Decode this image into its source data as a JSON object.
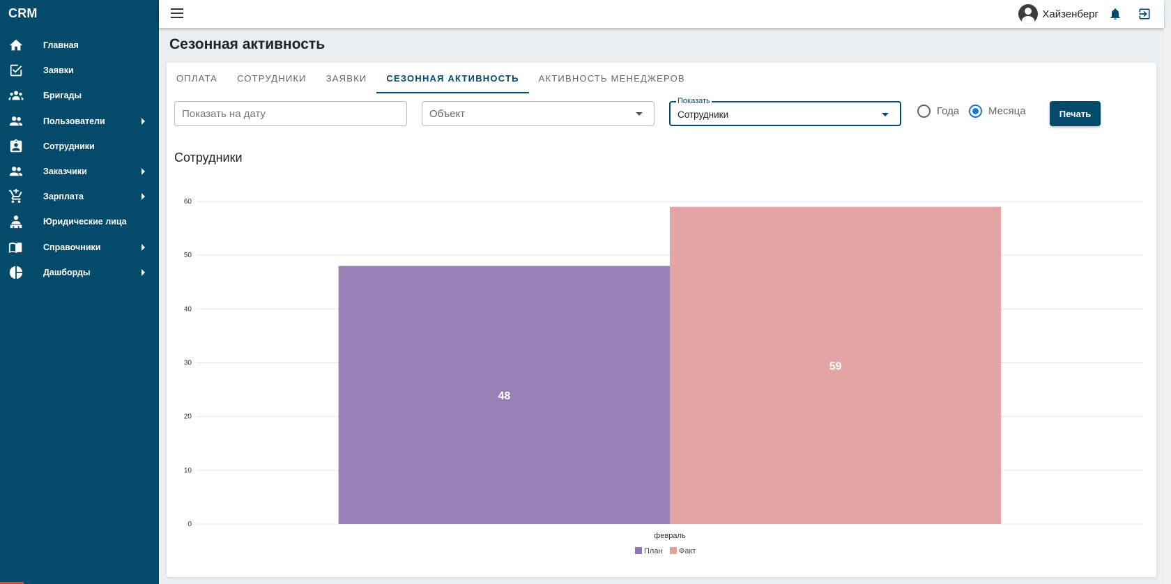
{
  "app": {
    "brand": "CRM"
  },
  "sidebar": {
    "items": [
      {
        "label": "Главная",
        "icon": "home-icon",
        "has_submenu": false
      },
      {
        "label": "Заявки",
        "icon": "checkbox-icon",
        "has_submenu": false
      },
      {
        "label": "Бригады",
        "icon": "groups-icon",
        "has_submenu": false
      },
      {
        "label": "Пользователи",
        "icon": "people-icon",
        "has_submenu": true
      },
      {
        "label": "Сотрудники",
        "icon": "badge-icon",
        "has_submenu": false
      },
      {
        "label": "Заказчики",
        "icon": "people-icon",
        "has_submenu": true
      },
      {
        "label": "Зарплата",
        "icon": "cart-icon",
        "has_submenu": true
      },
      {
        "label": "Юридические лица",
        "icon": "person-desk-icon",
        "has_submenu": false
      },
      {
        "label": "Справочники",
        "icon": "book-icon",
        "has_submenu": true
      },
      {
        "label": "Дашборды",
        "icon": "pie-chart-icon",
        "has_submenu": true
      }
    ]
  },
  "topbar": {
    "user_name": "Хайзенберг"
  },
  "page": {
    "title": "Сезонная активность"
  },
  "tabs": [
    {
      "label": "Оплата",
      "active": false
    },
    {
      "label": "Сотрудники",
      "active": false
    },
    {
      "label": "Заявки",
      "active": false
    },
    {
      "label": "Сезонная активность",
      "active": true
    },
    {
      "label": "Активность менеджеров",
      "active": false
    }
  ],
  "filters": {
    "date": {
      "placeholder": "Показать на дату",
      "value": ""
    },
    "object": {
      "placeholder": "Объект"
    },
    "show": {
      "label": "Показать",
      "value": "Сотрудники"
    },
    "period": {
      "options": [
        "Года",
        "Месяца"
      ],
      "selected": "Месяца"
    },
    "print_label": "Печать"
  },
  "colors": {
    "accent": "#034a6b",
    "plan": "#9079b0",
    "fact": "#e0a09f"
  },
  "chart_data": {
    "type": "bar",
    "title": "Сотрудники",
    "categories": [
      "февраль"
    ],
    "series": [
      {
        "name": "План",
        "values": [
          48
        ],
        "color": "#9079b0"
      },
      {
        "name": "Факт",
        "values": [
          59
        ],
        "color": "#e0a09f"
      }
    ],
    "ylim": [
      0,
      60
    ],
    "yticks": [
      0,
      10,
      20,
      30,
      40,
      50,
      60
    ],
    "grid": true,
    "data_labels": true,
    "legend": "bottom-center"
  }
}
